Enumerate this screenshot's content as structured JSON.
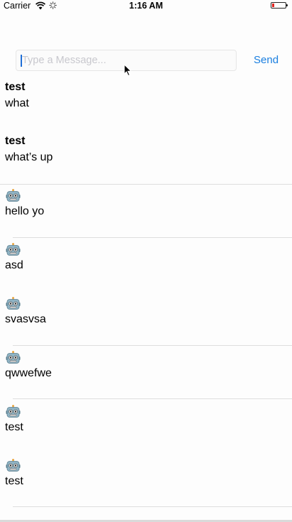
{
  "status_bar": {
    "carrier": "Carrier",
    "time": "1:16 AM",
    "battery_color": "#e0231e"
  },
  "compose": {
    "placeholder": "Type a Message...",
    "value": "",
    "send_label": "Send"
  },
  "messages": [
    {
      "sender": "test",
      "text": "what",
      "icon": null
    },
    {
      "sender": "test",
      "text": "what’s up",
      "icon": null
    },
    {
      "sender": "",
      "text": "hello yo",
      "icon": "robot-icon"
    },
    {
      "sender": "",
      "text": "asd",
      "icon": "robot-icon"
    },
    {
      "sender": "",
      "text": "svasvsa",
      "icon": "robot-icon"
    },
    {
      "sender": "",
      "text": "qwwefwe",
      "icon": "robot-icon"
    },
    {
      "sender": "",
      "text": "test",
      "icon": "robot-icon"
    },
    {
      "sender": "",
      "text": "test",
      "icon": "robot-icon"
    }
  ],
  "colors": {
    "accent": "#1a7fe0",
    "separator": "#dedede"
  }
}
